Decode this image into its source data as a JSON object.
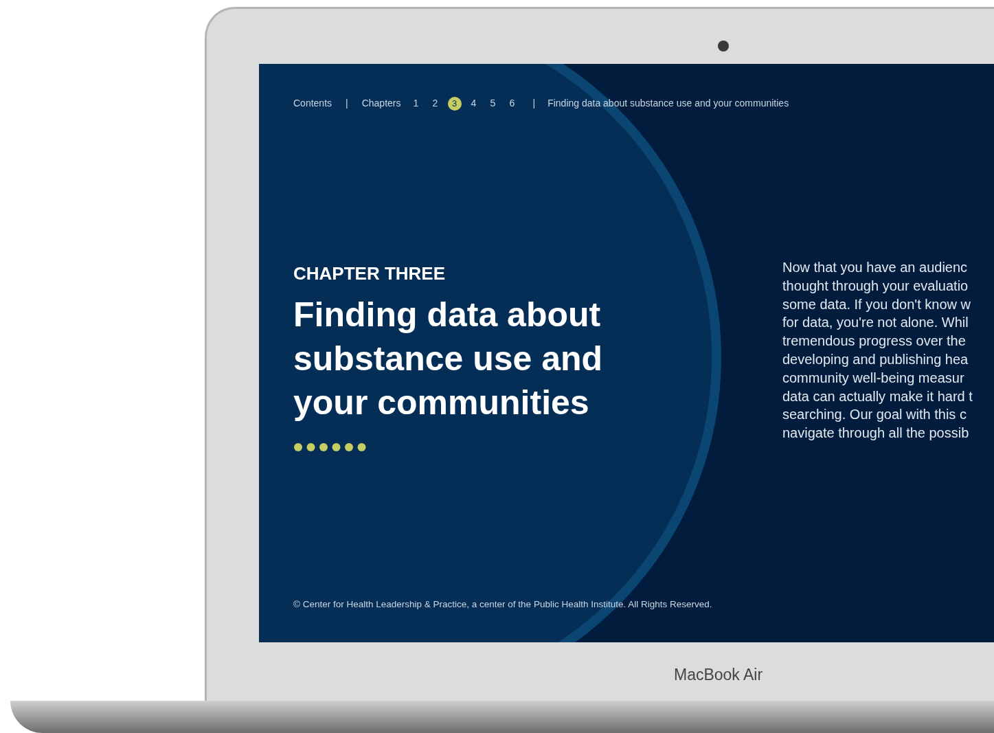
{
  "nav": {
    "contents": "Contents",
    "separator_1": "|",
    "chapters_label": "Chapters",
    "chapters": [
      {
        "label": "1",
        "selected": false
      },
      {
        "label": "2",
        "selected": false
      },
      {
        "label": "3",
        "selected": true
      },
      {
        "label": "4",
        "selected": false
      },
      {
        "label": "5",
        "selected": false
      },
      {
        "label": "6",
        "selected": false
      }
    ],
    "separator_2": "|",
    "current_title": "Finding data about substance use and your communities"
  },
  "hero": {
    "eyebrow": "CHAPTER THREE",
    "title": "Finding data about substance use and your communities"
  },
  "intro_lines": [
    "Now that you have an audienc",
    "thought through your evaluatio",
    "some data. If you don't know w",
    "for data, you're not alone. Whil",
    "tremendous progress over the",
    "developing and publishing hea",
    "community well-being measur",
    "data can actually make it hard t",
    "searching. Our goal with this c",
    "navigate through all the possib"
  ],
  "footer": "© Center for Health Leadership & Practice, a center of the Public Health Institute. All Rights Reserved.",
  "device_label": "MacBook Air"
}
